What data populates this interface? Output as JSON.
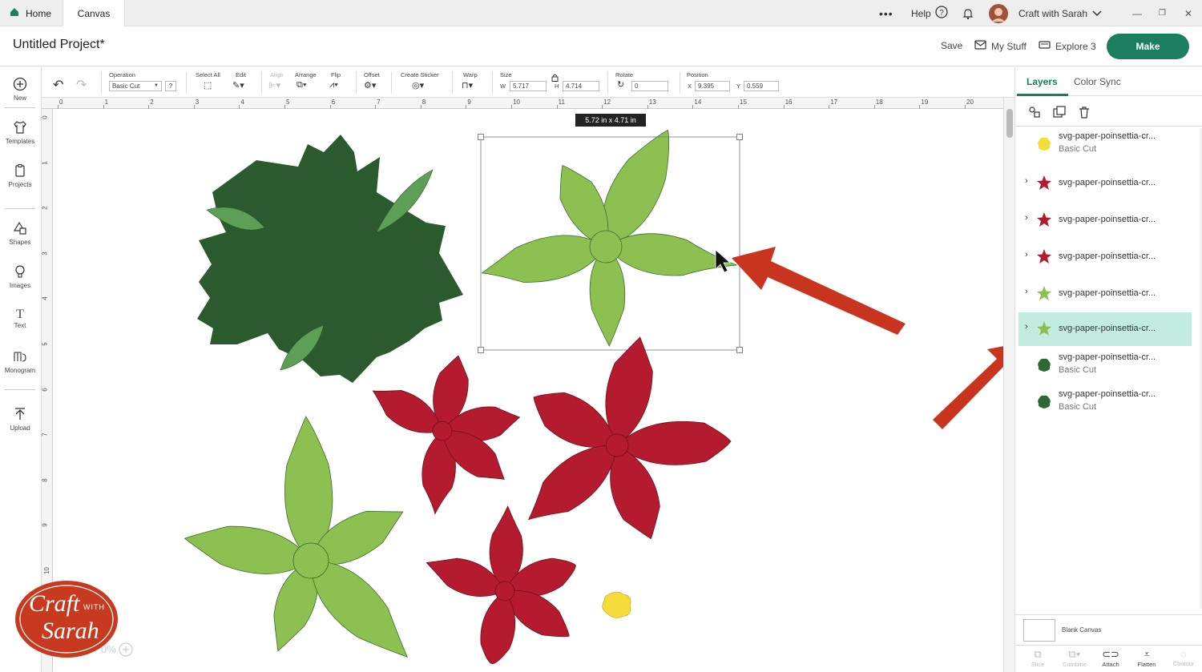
{
  "tabs": {
    "home": "Home",
    "canvas": "Canvas"
  },
  "topbar": {
    "more": "•••",
    "help": "Help",
    "account": "Craft with Sarah"
  },
  "header": {
    "project_title": "Untitled Project*",
    "save": "Save",
    "my_stuff": "My Stuff",
    "machine": "Explore 3",
    "make": "Make"
  },
  "left_tools": {
    "new": "New",
    "templates": "Templates",
    "projects": "Projects",
    "shapes": "Shapes",
    "images": "Images",
    "text": "Text",
    "monogram": "Monogram",
    "upload": "Upload"
  },
  "edit_toolbar": {
    "operation_label": "Operation",
    "operation_value": "Basic Cut",
    "select_all": "Select All",
    "edit": "Edit",
    "align": "Align",
    "arrange": "Arrange",
    "flip": "Flip",
    "offset": "Offset",
    "create_sticker": "Create Sticker",
    "warp": "Warp",
    "size_label": "Size",
    "w_label": "W",
    "w_value": "5.717",
    "h_label": "H",
    "h_value": "4.714",
    "rotate_label": "Rotate",
    "rotate_value": "0",
    "position_label": "Position",
    "x_label": "X",
    "x_value": "9.395",
    "y_label": "Y",
    "y_value": "0.559"
  },
  "ruler": {
    "h": [
      "0",
      "1",
      "2",
      "3",
      "4",
      "5",
      "6",
      "7",
      "8",
      "9",
      "10",
      "11",
      "12",
      "13",
      "14",
      "15",
      "16",
      "17",
      "18",
      "19",
      "20"
    ],
    "v": [
      "0",
      "1",
      "2",
      "3",
      "4",
      "5",
      "6",
      "7",
      "8",
      "9",
      "10"
    ]
  },
  "canvas": {
    "size_tooltip": "5.72  in x 4.71  in",
    "zoom": "0%"
  },
  "logo": {
    "line1": "Craft",
    "with": "WITH",
    "line2": "Sarah"
  },
  "right_panel": {
    "tab_layers": "Layers",
    "tab_color_sync": "Color Sync",
    "layers": [
      {
        "name": "svg-paper-poinsettia-cr...",
        "sub": "Basic Cut",
        "color": "#f6dc3a",
        "grouped": false,
        "selected": false
      },
      {
        "name": "svg-paper-poinsettia-cr...",
        "sub": "",
        "color": "#b01b2e",
        "grouped": true,
        "selected": false
      },
      {
        "name": "svg-paper-poinsettia-cr...",
        "sub": "",
        "color": "#b01b2e",
        "grouped": true,
        "selected": false
      },
      {
        "name": "svg-paper-poinsettia-cr...",
        "sub": "",
        "color": "#b01b2e",
        "grouped": true,
        "selected": false
      },
      {
        "name": "svg-paper-poinsettia-cr...",
        "sub": "",
        "color": "#8cc152",
        "grouped": true,
        "selected": false
      },
      {
        "name": "svg-paper-poinsettia-cr...",
        "sub": "",
        "color": "#8cc152",
        "grouped": true,
        "selected": true
      },
      {
        "name": "svg-paper-poinsettia-cr...",
        "sub": "Basic Cut",
        "color": "#2b6a35",
        "grouped": false,
        "selected": false
      },
      {
        "name": "svg-paper-poinsettia-cr...",
        "sub": "Basic Cut",
        "color": "#2b6a35",
        "grouped": false,
        "selected": false
      }
    ],
    "blank_canvas": "Blank Canvas",
    "bottom_actions": {
      "slice": "Slice",
      "combine": "Combine",
      "attach": "Attach",
      "flatten": "Flatten",
      "contour": "Contour"
    }
  },
  "colors": {
    "accent": "#1b7f5f",
    "selected_layer": "#c3ece0",
    "dark_green": "#2b5a2e",
    "light_green": "#8cc152",
    "red": "#b51b2f",
    "yellow": "#f6dc3a",
    "arrow": "#c9341e"
  }
}
